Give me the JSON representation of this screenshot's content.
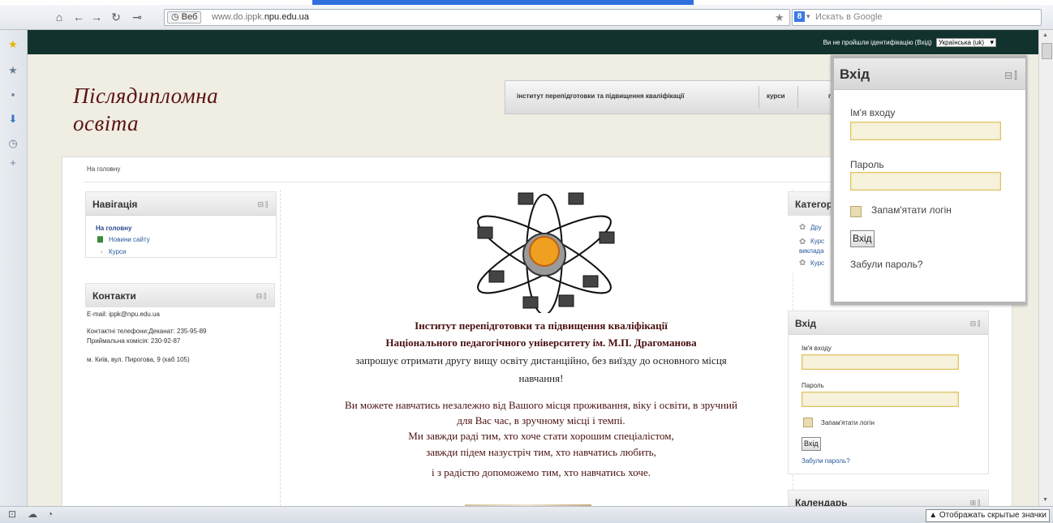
{
  "browser": {
    "url_chip": "Веб",
    "url_prefix": "www.do.ippk.",
    "url_domain": "npu.edu.ua",
    "search_placeholder": "Искать в Google",
    "search_engine_letter": "8",
    "status_hidden_icons": "Отображать скрытые значки",
    "nav_icons": [
      "home-icon",
      "back-icon",
      "forward-icon",
      "reload-icon",
      "key-icon"
    ],
    "sidebar_icons": [
      "star-icon",
      "bookmark-star-icon",
      "note-icon",
      "save-icon",
      "history-icon",
      "plus-icon"
    ]
  },
  "site": {
    "login_status": "Ви не пройшли ідентифікацію (Вхід)",
    "language": "Українська (uk)",
    "title": "Післядипломна освіта",
    "menu": [
      "інститут перепідготовки та підвищення кваліфікації",
      "курси",
      "п"
    ],
    "breadcrumb": "На головну"
  },
  "navigation_block": {
    "title": "Навігація",
    "home": "На головну",
    "site_news": "Новини сайту",
    "courses": "Курси"
  },
  "contacts_block": {
    "title": "Контакти",
    "email": "E-mail: ippk@npu.edu.ua",
    "phones_line1": "Контактні телефони:Деканат: 235-95-89",
    "phones_line2": "Приймальна комісія: 230-92-87",
    "address": "м. Київ, вул. Пирогова, 9 (каб 105)"
  },
  "main": {
    "institute_line1": "Інститут перепідготовки та підвищення кваліфікації",
    "institute_line2": "Національного педагогічного університету ім. М.П. Драгоманова",
    "invite_line1": "запрошує отримати другу вищу освіту дистанційно, без виїзду до основного місця",
    "invite_line2": "навчання!",
    "text_line1": "Ви можете навчатись незалежно від Вашого місця проживання, віку і освіти, в зручний",
    "text_line2": "для Вас час, в зручному місці і темпі.",
    "text_line3": "Ми завжди раді тим, хто хоче стати хорошим спеціалістом,",
    "text_line4": "завжди підем назустріч тим, хто навчатись любить,",
    "text_line5": "і з радістю допоможемо тим, хто навчатись хоче."
  },
  "categories_block": {
    "title": "Категор",
    "item1": "Дру",
    "item2": "Курс",
    "item2_sub": "виклада",
    "item3": "Курс"
  },
  "login_block": {
    "title": "Вхід",
    "username_label": "Ім'я входу",
    "password_label": "Пароль",
    "remember_label": "Запам'ятати логін",
    "submit": "Вхід",
    "forgot": "Забули пароль?"
  },
  "calendar_block": {
    "title": "Календарь"
  },
  "popup_login": {
    "title": "Вхід",
    "username_label": "Ім'я входу",
    "password_label": "Пароль",
    "remember_label": "Запам'ятати логін",
    "submit": "Вхід",
    "forgot": "Забули пароль?"
  },
  "colors": {
    "dark_header": "#12332d",
    "title_color": "#5a1212",
    "accent_field": "#e0c060"
  }
}
